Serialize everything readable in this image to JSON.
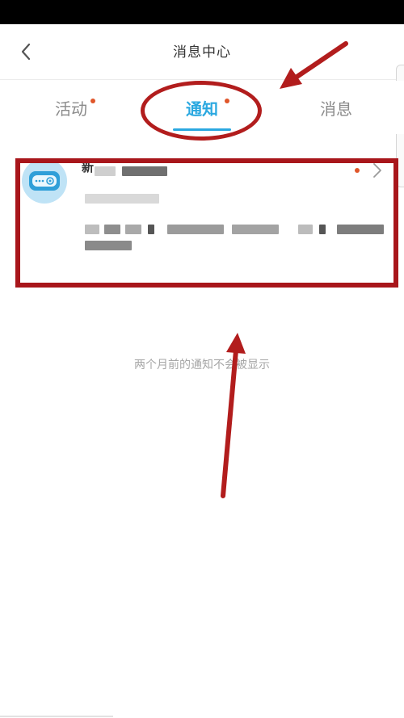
{
  "header": {
    "title": "消息中心",
    "back_icon": "chevron-left-icon"
  },
  "tabs": [
    {
      "label": "活动",
      "has_dot": true,
      "active": false
    },
    {
      "label": "通知",
      "has_dot": true,
      "active": true
    },
    {
      "label": "消息",
      "has_dot": false,
      "active": false
    }
  ],
  "notice": {
    "title_fragment": "新",
    "icon": "robot-icon",
    "unread": true,
    "chevron_icon": "chevron-right-icon"
  },
  "empty_hint": "两个月前的通知不会被显示",
  "colors": {
    "accent": "#2aa8e0",
    "unread_dot": "#e0562a",
    "annotation": "#b21d1d"
  }
}
